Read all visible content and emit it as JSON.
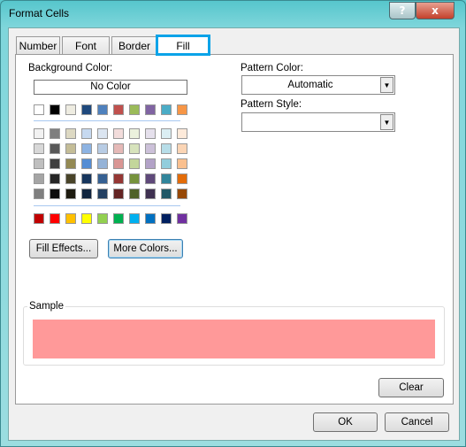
{
  "window": {
    "title": "Format Cells",
    "help_icon": "?",
    "close_icon": "x"
  },
  "tabs": [
    {
      "label": "Number"
    },
    {
      "label": "Font"
    },
    {
      "label": "Border"
    },
    {
      "label": "Fill",
      "active": true
    }
  ],
  "fill": {
    "background_color_label": "Background Color:",
    "no_color_label": "No Color",
    "theme_colors": [
      "#FFFFFF",
      "#000000",
      "#EEECE1",
      "#1F497D",
      "#4F81BD",
      "#C0504D",
      "#9BBB59",
      "#8064A2",
      "#4BACC6",
      "#F79646"
    ],
    "tint_rows": [
      [
        "#F2F2F2",
        "#7F7F7F",
        "#DDD9C3",
        "#C6D9F0",
        "#DBE5F1",
        "#F2DCDB",
        "#EBF1DD",
        "#E5E0EC",
        "#DBEEF3",
        "#FDEADA"
      ],
      [
        "#D8D8D8",
        "#595959",
        "#C4BD97",
        "#8DB3E2",
        "#B8CCE4",
        "#E5B9B7",
        "#D7E3BC",
        "#CCC1D9",
        "#B7DDE8",
        "#FBD5B5"
      ],
      [
        "#BFBFBF",
        "#3F3F3F",
        "#938953",
        "#548DD4",
        "#95B3D7",
        "#D99694",
        "#C3D69B",
        "#B2A2C7",
        "#92CDDC",
        "#FAC08F"
      ],
      [
        "#A5A5A5",
        "#262626",
        "#494429",
        "#17365D",
        "#366092",
        "#953734",
        "#76923C",
        "#5F497A",
        "#31859B",
        "#E36C09"
      ],
      [
        "#7F7F7F",
        "#0C0C0C",
        "#1D1B10",
        "#0F243E",
        "#244061",
        "#632423",
        "#4F6128",
        "#3F3151",
        "#205867",
        "#974806"
      ]
    ],
    "standard_colors": [
      "#C00000",
      "#FF0000",
      "#FFC000",
      "#FFFF00",
      "#92D050",
      "#00B050",
      "#00B0F0",
      "#0070C0",
      "#002060",
      "#7030A0"
    ],
    "fill_effects_label": "Fill Effects...",
    "more_colors_label": "More Colors...",
    "pattern_color_label": "Pattern Color:",
    "pattern_color_value": "Automatic",
    "pattern_style_label": "Pattern Style:",
    "pattern_style_value": "",
    "sample_label": "Sample",
    "sample_color": "#FF9999",
    "clear_label": "Clear"
  },
  "footer": {
    "ok_label": "OK",
    "cancel_label": "Cancel"
  }
}
